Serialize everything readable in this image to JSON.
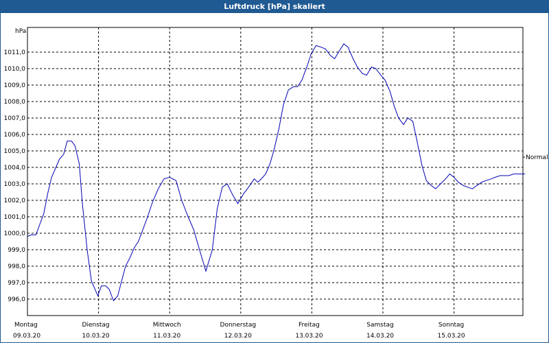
{
  "window": {
    "title": "Luftdruck [hPa] skaliert"
  },
  "chart_data": {
    "type": "line",
    "title": "Luftdruck [hPa] skaliert",
    "ylabel": "hPa",
    "ylim": [
      995.0,
      1012.5
    ],
    "grid": true,
    "yticks": [
      "996,0",
      "997,0",
      "998,0",
      "999,0",
      "1000,0",
      "1001,0",
      "1002,0",
      "1003,0",
      "1004,0",
      "1005,0",
      "1006,0",
      "1007,0",
      "1008,0",
      "1009,0",
      "1010,0",
      "1011,0"
    ],
    "ytick_values": [
      996,
      997,
      998,
      999,
      1000,
      1001,
      1002,
      1003,
      1004,
      1005,
      1006,
      1007,
      1008,
      1009,
      1010,
      1011
    ],
    "xlim": [
      0,
      7
    ],
    "xticks": [
      {
        "x": 0,
        "day": "Montag",
        "date": "09.03.20"
      },
      {
        "x": 1,
        "day": "Dienstag",
        "date": "10.03.20"
      },
      {
        "x": 2,
        "day": "Mittwoch",
        "date": "11.03.20"
      },
      {
        "x": 3,
        "day": "Donnerstag",
        "date": "12.03.20"
      },
      {
        "x": 4,
        "day": "Freitag",
        "date": "13.03.20"
      },
      {
        "x": 5,
        "day": "Samstag",
        "date": "14.03.20"
      },
      {
        "x": 6,
        "day": "Sonntag",
        "date": "15.03.20"
      }
    ],
    "reference_label": "Normal",
    "series": [
      {
        "color": "#0000b4",
        "x": [
          0.0,
          0.05,
          0.12,
          0.17,
          0.23,
          0.29,
          0.34,
          0.4,
          0.45,
          0.51,
          0.56,
          0.62,
          0.67,
          0.73,
          0.77,
          0.84,
          0.9,
          0.95,
          0.99,
          1.04,
          1.1,
          1.15,
          1.21,
          1.27,
          1.33,
          1.38,
          1.44,
          1.5,
          1.56,
          1.63,
          1.69,
          1.76,
          1.84,
          1.92,
          2.0,
          2.09,
          2.17,
          2.26,
          2.34,
          2.42,
          2.51,
          2.6,
          2.67,
          2.74,
          2.81,
          2.89,
          2.96,
          3.04,
          3.11,
          3.19,
          3.24,
          3.29,
          3.35,
          3.41,
          3.47,
          3.54,
          3.6,
          3.67,
          3.74,
          3.8,
          3.86,
          3.93,
          3.99,
          4.06,
          4.13,
          4.19,
          4.26,
          4.32,
          4.39,
          4.45,
          4.51,
          4.58,
          4.64,
          4.71,
          4.77,
          4.84,
          4.9,
          4.97,
          5.03,
          5.1,
          5.16,
          5.22,
          5.29,
          5.35,
          5.42,
          5.48,
          5.55,
          5.61,
          5.68,
          5.74,
          5.81,
          5.88,
          5.94,
          6.0,
          6.06,
          6.13,
          6.19,
          6.26,
          6.32,
          6.39,
          6.45,
          6.52,
          6.58,
          6.65,
          6.71,
          6.77,
          6.84,
          6.9,
          6.97,
          7.0
        ],
        "y": [
          999.8,
          999.9,
          999.9,
          1000.5,
          1001.2,
          1002.5,
          1003.4,
          1004.0,
          1004.5,
          1004.8,
          1005.6,
          1005.6,
          1005.3,
          1004.2,
          1001.9,
          999.0,
          997.1,
          996.6,
          996.2,
          996.8,
          996.8,
          996.6,
          995.9,
          996.2,
          997.2,
          998.0,
          998.5,
          999.1,
          999.5,
          1000.3,
          1001.0,
          1001.9,
          1002.7,
          1003.3,
          1003.4,
          1003.2,
          1002.0,
          1001.0,
          1000.2,
          999.0,
          997.7,
          999.0,
          1001.5,
          1002.8,
          1003.0,
          1002.3,
          1001.8,
          1002.4,
          1002.8,
          1003.3,
          1003.1,
          1003.3,
          1003.6,
          1004.2,
          1005.1,
          1006.4,
          1007.8,
          1008.7,
          1008.9,
          1008.9,
          1009.3,
          1010.1,
          1010.9,
          1011.4,
          1011.3,
          1011.2,
          1010.8,
          1010.6,
          1011.1,
          1011.5,
          1011.3,
          1010.6,
          1010.1,
          1009.7,
          1009.6,
          1010.1,
          1010.0,
          1009.6,
          1009.3,
          1008.6,
          1007.7,
          1007.0,
          1006.6,
          1007.0,
          1006.8,
          1005.6,
          1004.1,
          1003.2,
          1002.9,
          1002.7,
          1003.0,
          1003.3,
          1003.6,
          1003.4,
          1003.1,
          1002.9,
          1002.8,
          1002.7,
          1002.9,
          1003.1,
          1003.2,
          1003.3,
          1003.4,
          1003.5,
          1003.5,
          1003.5,
          1003.6,
          1003.6,
          1003.6,
          1003.6
        ]
      }
    ]
  }
}
